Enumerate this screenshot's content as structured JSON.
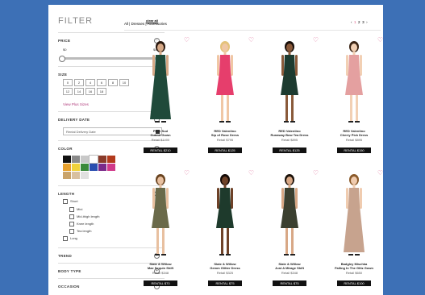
{
  "sidebar": {
    "title": "FILTER",
    "clear_all": "clear all",
    "price": {
      "title": "PRICE",
      "min": "$0",
      "max": "$450",
      "low": 0.0,
      "high": 1.0
    },
    "size": {
      "title": "SIZE",
      "options": [
        "0",
        "2",
        "4",
        "6",
        "8",
        "10",
        "12",
        "14",
        "16",
        "18"
      ],
      "plus_link": "View Plus Sizes"
    },
    "delivery": {
      "title": "DELIVERY DATE",
      "placeholder": "Rental Delivery Date"
    },
    "color": {
      "title": "COLOR",
      "swatches": [
        "#111111",
        "#8a8a8a",
        "#c8c8c8",
        "#ffffff",
        "#8a3b2a",
        "#b23a1c",
        "#e7a12d",
        "#f0d23a",
        "#3a8a3a",
        "#2a4fb0",
        "#7a2a8a",
        "#d03a8a",
        "#c9a36a",
        "#d8c0a0",
        "#e0e0e0"
      ]
    },
    "length": {
      "title": "LENGTH",
      "short": "Short",
      "mini": "Mini",
      "mid_thigh": "Mid-thigh length",
      "knee": "Knee length",
      "tea": "Tea length",
      "long": "Long"
    },
    "trend": "TREND",
    "body_type": "BODY TYPE",
    "occasion": "OCCASION"
  },
  "main": {
    "breadcrumb": "All | Dresses | Accessories",
    "pager": {
      "prev": "‹",
      "p1": "1",
      "p2": "2",
      "p3": "3",
      "next": "›"
    },
    "products": [
      {
        "name1": "Plein Sud",
        "name2": "Cutout Gown",
        "retail": "Retail $1400",
        "rental": "RENTAL $210",
        "dress": "#1f4a3a",
        "skin": "#d7a987",
        "hair": "#2b1a10",
        "long": true
      },
      {
        "name1": "RED Valentino",
        "name2": "Sip of Rose Dress",
        "retail": "Retail $795",
        "rental": "RENTAL $125",
        "dress": "#e63e6c",
        "skin": "#f0c7a5",
        "hair": "#e4c27a",
        "long": false
      },
      {
        "name1": "RED Valentino",
        "name2": "Runaway Bow Tea Dress",
        "retail": "Retail $895",
        "rental": "RENTAL $125",
        "dress": "#1d3b30",
        "skin": "#8a5a3a",
        "hair": "#1a100a",
        "long": false
      },
      {
        "name1": "RED Valentino",
        "name2": "Cherry Pick Dress",
        "retail": "Retail $895",
        "rental": "RENTAL $150",
        "dress": "#e4a0a0",
        "skin": "#f2d0b4",
        "hair": "#3a2414",
        "long": false
      },
      {
        "name1": "Slate & Willow",
        "name2": "Mae Sequin Shift",
        "retail": "Retail $348",
        "rental": "RENTAL $70",
        "dress": "#6a6a4a",
        "skin": "#e8c0a0",
        "hair": "#6a4420",
        "long": false
      },
      {
        "name1": "Slate & Willow",
        "name2": "Gemm Glitter Dress",
        "retail": "Retail $325",
        "rental": "RENTAL $75",
        "dress": "#1e3a2c",
        "skin": "#6e4228",
        "hair": "#140a06",
        "long": false
      },
      {
        "name1": "Slate & Willow",
        "name2": "Just A Mirage Shift",
        "retail": "Retail $348",
        "rental": "RENTAL $75",
        "dress": "#3b4030",
        "skin": "#d8a886",
        "hair": "#1c120a",
        "long": false
      },
      {
        "name1": "Badgley Mischka",
        "name2": "Falling In The Glitz Gown",
        "retail": "Retail $650",
        "rental": "RENTAL $100",
        "dress": "#c7a38e",
        "skin": "#f0ccb0",
        "hair": "#8a5a2a",
        "long": true
      }
    ]
  }
}
